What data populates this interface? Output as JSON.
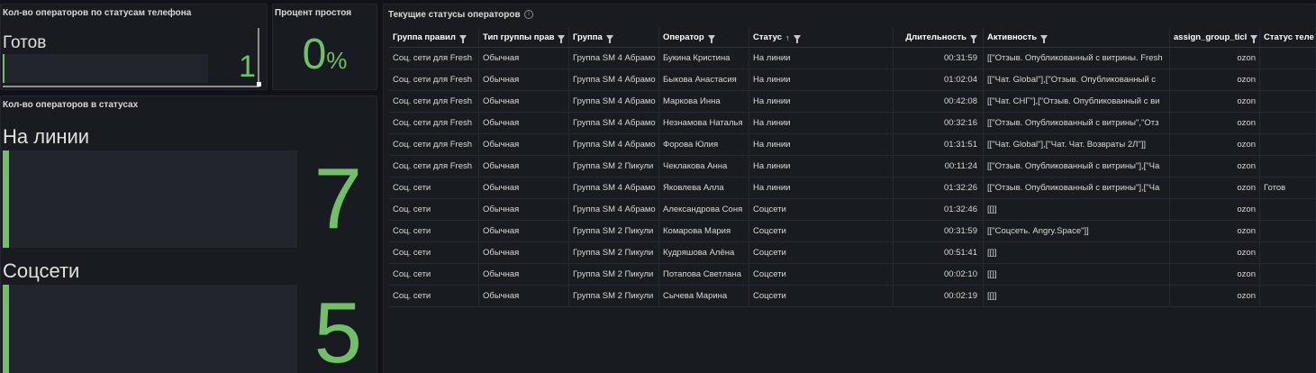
{
  "panel_phone": {
    "title": "Кол-во операторов по статусам телефона",
    "label": "Готов",
    "value": "1",
    "level_fraction": 0.01
  },
  "panel_idle": {
    "title": "Процент простоя",
    "value": "0",
    "unit": "%"
  },
  "panel_status": {
    "title": "Кол-во операторов в статусах",
    "items": [
      {
        "label": "На линии",
        "value": "7"
      },
      {
        "label": "Соцсети",
        "value": "5"
      }
    ]
  },
  "table": {
    "title": "Текущие статусы операторов",
    "columns": [
      "Группа правил",
      "Тип группы прав",
      "Группа",
      "Оператор",
      "Статус",
      "Длительность",
      "Активность",
      "assign_group_ticl",
      "Статус теле"
    ],
    "rows": [
      [
        "Соц. сети для Fresh",
        "Обычная",
        "Группа SM 4 Абрамо",
        "Букина Кристина",
        "На линии",
        "00:31:59",
        "[[\"Отзыв. Опубликованный с витрины. Fresh",
        "ozon",
        ""
      ],
      [
        "Соц. сети для Fresh",
        "Обычная",
        "Группа SM 4 Абрамо",
        "Быкова Анастасия",
        "На линии",
        "01:02:04",
        "[[\"Чат. Global\"],[\"Отзыв. Опубликованный с",
        "ozon",
        ""
      ],
      [
        "Соц. сети для Fresh",
        "Обычная",
        "Группа SM 4 Абрамо",
        "Маркова Инна",
        "На линии",
        "00:42:08",
        "[[\"Чат. СНГ\"],[\"Отзыв. Опубликованный с ви",
        "ozon",
        ""
      ],
      [
        "Соц. сети для Fresh",
        "Обычная",
        "Группа SM 4 Абрамо",
        "Незнамова Наталья",
        "На линии",
        "00:32:16",
        "[[\"Отзыв. Опубликованный с витрины\",\"Отз",
        "ozon",
        ""
      ],
      [
        "Соц. сети для Fresh",
        "Обычная",
        "Группа SM 4 Абрамо",
        "Форова Юлия",
        "На линии",
        "01:31:51",
        "[[\"Чат. Global\"],[\"Чат. Чат. Возвраты 2Л\"]]",
        "ozon",
        ""
      ],
      [
        "Соц. сети для Fresh",
        "Обычная",
        "Группа SM 2 Пикули",
        "Чеклакова Анна",
        "На линии",
        "00:11:24",
        "[[\"Отзыв. Опубликованный с витрины\"],[\"Ча",
        "ozon",
        ""
      ],
      [
        "Соц. сети",
        "Обычная",
        "Группа SM 4 Абрамо",
        "Яковлева Алла",
        "На линии",
        "01:32:26",
        "[[\"Отзыв. Опубликованный с витрины\"],[\"Ча",
        "ozon",
        "Готов"
      ],
      [
        "Соц. сети",
        "Обычная",
        "Группа SM 4 Абрамо",
        "Александрова Соня",
        "Соцсети",
        "01:32:46",
        "[[]]",
        "ozon",
        ""
      ],
      [
        "Соц. сети",
        "Обычная",
        "Группа SM 2 Пикули",
        "Комарова Мария",
        "Соцсети",
        "00:31:59",
        "[[\"Соцсеть. Angry.Space\"]]",
        "ozon",
        ""
      ],
      [
        "Соц. сети",
        "Обычная",
        "Группа SM 2 Пикули",
        "Кудряшова Алёна",
        "Соцсети",
        "00:51:41",
        "[[]]",
        "ozon",
        ""
      ],
      [
        "Соц. сети",
        "Обычная",
        "Группа SM 2 Пикули",
        "Потапова Светлана",
        "Соцсети",
        "00:02:10",
        "[[]]",
        "ozon",
        ""
      ],
      [
        "Соц. сети",
        "Обычная",
        "Группа SM 2 Пикули",
        "Сычева Марина",
        "Соцсети",
        "00:02:19",
        "[[]]",
        "ozon",
        ""
      ]
    ]
  },
  "colors": {
    "accent": "#73bf69",
    "panel_bg": "#181b1f",
    "page_bg": "#111217"
  }
}
